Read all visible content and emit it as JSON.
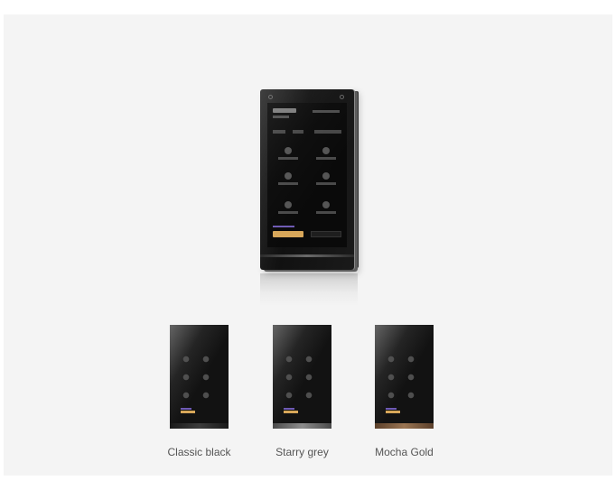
{
  "variants": [
    {
      "label": "Classic black",
      "finish": "black",
      "frame_color": "#2b2b2b"
    },
    {
      "label": "Starry grey",
      "finish": "grey",
      "frame_color": "#8d8d8d"
    },
    {
      "label": "Mocha Gold",
      "finish": "gold",
      "frame_color": "#9a7553"
    }
  ],
  "colors": {
    "background": "#ffffff",
    "panel": "#f4f4f4",
    "label_text": "#555555",
    "accent_gold": "#d8a75a",
    "accent_purple": "#6f5bb5"
  }
}
